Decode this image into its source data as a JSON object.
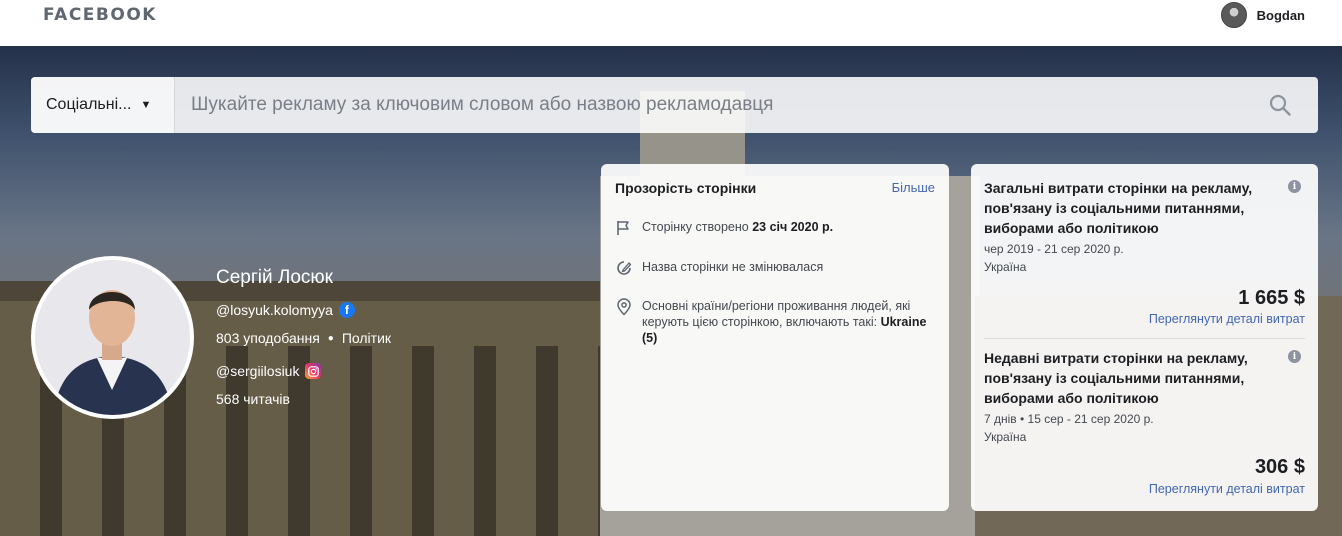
{
  "topbar": {
    "brand": "FACEBOOK",
    "user_name": "Bogdan"
  },
  "search": {
    "category": "Соціальні...",
    "placeholder": "Шукайте рекламу за ключовим словом або назвою рекламодавця"
  },
  "profile": {
    "name": "Сергій Лосюк",
    "facebook_handle": "@losyuk.kolomyya",
    "likes": "803 уподобання",
    "category": "Політик",
    "instagram_handle": "@sergiilosiuk",
    "followers": "568 читачів"
  },
  "transparency": {
    "title": "Прозорість сторінки",
    "more_link": "Більше",
    "created_prefix": "Сторінку створено",
    "created_date": "23 січ 2020 р.",
    "name_unchanged": "Назва сторінки не змінювалася",
    "countries_text": "Основні країни/регіони проживання людей, які керують цією сторінкою, включають такі:",
    "countries_value": "Ukraine (5)"
  },
  "spending": {
    "total": {
      "title": "Загальні витрати сторінки на рекламу, пов'язану із соціальними питаннями, виборами або політикою",
      "period": "чер 2019 - 21 сер 2020 р.",
      "region": "Україна",
      "amount": "1 665 $",
      "link": "Переглянути деталі витрат"
    },
    "recent": {
      "title": "Недавні витрати сторінки на рекламу, пов'язану із соціальними питаннями, виборами або політикою",
      "period": "7 днів • 15 сер - 21 сер 2020 р.",
      "region": "Україна",
      "amount": "306 $",
      "link": "Переглянути деталі витрат"
    }
  }
}
